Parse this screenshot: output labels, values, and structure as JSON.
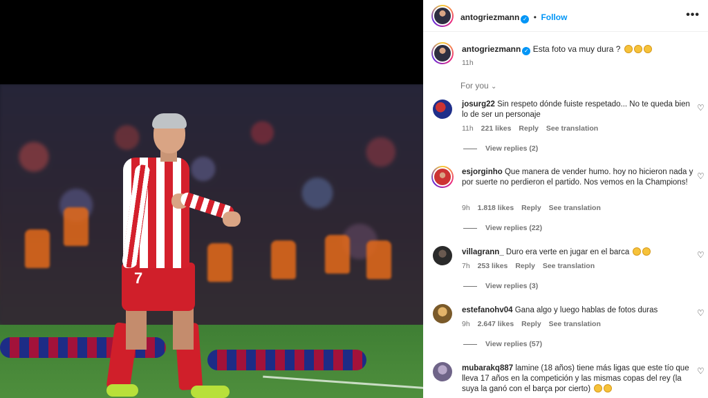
{
  "post": {
    "username": "antogriezmann",
    "follow_label": "Follow",
    "more_label": "•••",
    "caption_text": "Esta foto va muy dura ?",
    "caption_time": "11h",
    "photo_shirt_number": "7"
  },
  "comments_section": {
    "sort_label": "For you"
  },
  "comments": [
    {
      "username": "josurg22",
      "text": "Sin respeto dónde fuiste respetado... No te queda bien lo de ser un personaje",
      "time": "11h",
      "likes": "221 likes",
      "reply": "Reply",
      "translate": "See translation",
      "view_replies": "View replies (2)"
    },
    {
      "username": "esjorginho",
      "text": "Que manera de vender humo. hoy no hicieron nada y por suerte no perdieron el partido. Nos vemos en la Champions!",
      "time": "9h",
      "likes": "1.818 likes",
      "reply": "Reply",
      "translate": "See translation",
      "view_replies": "View replies (22)"
    },
    {
      "username": "villagrann_",
      "text": "Duro era verte en jugar en el barca",
      "time": "7h",
      "likes": "253 likes",
      "reply": "Reply",
      "translate": "See translation",
      "view_replies": "View replies (3)"
    },
    {
      "username": "estefanohv04",
      "text": "Gana algo y luego hablas de fotos duras",
      "time": "9h",
      "likes": "2.647 likes",
      "reply": "Reply",
      "translate": "See translation",
      "view_replies": "View replies (57)"
    },
    {
      "username": "mubarakq887",
      "text": "lamine (18 años) tiene más ligas que este tío que lleva 17 años en la competición y las mismas copas del rey (la suya la ganó con el barça por cierto)"
    }
  ],
  "icons": {
    "verified": "verified-badge-icon",
    "heart": "heart-outline-icon",
    "chevron": "chevron-down-icon",
    "more": "more-horizontal-icon"
  },
  "colors": {
    "accent": "#0095f6",
    "muted": "#737373",
    "text": "#262626"
  }
}
